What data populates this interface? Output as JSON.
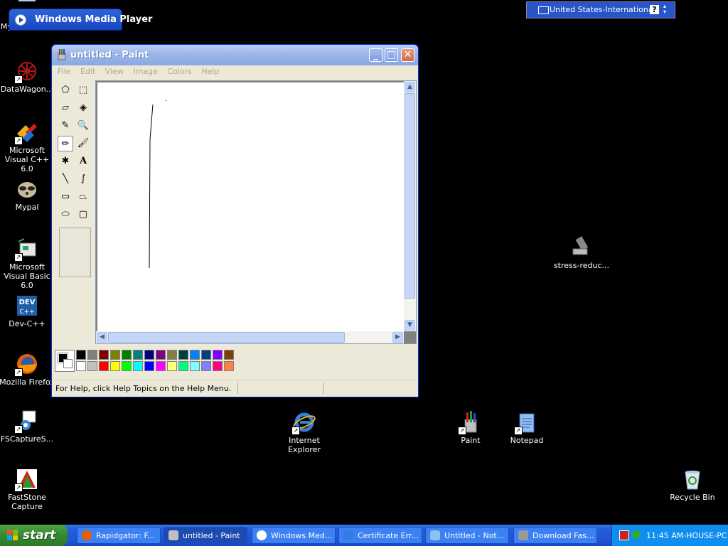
{
  "desktop": {
    "icons": [
      {
        "label": "My Computer"
      },
      {
        "label": "DataWagon..."
      },
      {
        "label": "Microsoft Visual C++ 6.0"
      },
      {
        "label": "Mypal"
      },
      {
        "label": "Microsoft Visual Basic 6.0"
      },
      {
        "label": "Dev-C++"
      },
      {
        "label": "Mozilla Firefox"
      },
      {
        "label": "FSCaptureS..."
      },
      {
        "label": "FastStone Capture"
      },
      {
        "label": "Internet Explorer"
      },
      {
        "label": "Paint"
      },
      {
        "label": "Notepad"
      },
      {
        "label": "stress-reduc..."
      },
      {
        "label": "Recycle Bin"
      }
    ]
  },
  "wmp_window": {
    "title": "Windows Media Player"
  },
  "language_bar": {
    "language": "United States-International",
    "help_label": "?"
  },
  "paint": {
    "title": "untitled - Paint",
    "menu": [
      "File",
      "Edit",
      "View",
      "Image",
      "Colors",
      "Help"
    ],
    "status_text": "For Help, click Help Topics on the Help Menu.",
    "tools": [
      {
        "icon": "free-form-select-icon",
        "glyph": "⬠"
      },
      {
        "icon": "rect-select-icon",
        "glyph": "⬚"
      },
      {
        "icon": "eraser-icon",
        "glyph": "▱"
      },
      {
        "icon": "fill-bucket-icon",
        "glyph": "◈"
      },
      {
        "icon": "color-picker-icon",
        "glyph": "✎"
      },
      {
        "icon": "magnifier-icon",
        "glyph": "🔍"
      },
      {
        "icon": "pencil-icon",
        "glyph": "✏"
      },
      {
        "icon": "brush-icon",
        "glyph": "🖌"
      },
      {
        "icon": "airbrush-icon",
        "glyph": "✱"
      },
      {
        "icon": "text-icon",
        "glyph": "A"
      },
      {
        "icon": "line-icon",
        "glyph": "╲"
      },
      {
        "icon": "curve-icon",
        "glyph": "∫"
      },
      {
        "icon": "rectangle-icon",
        "glyph": "▭"
      },
      {
        "icon": "polygon-icon",
        "glyph": "⏢"
      },
      {
        "icon": "ellipse-icon",
        "glyph": "⬭"
      },
      {
        "icon": "rounded-rectangle-icon",
        "glyph": "▢"
      }
    ],
    "selected_tool": "pencil",
    "palette_colors": [
      "#000000",
      "#808080",
      "#800000",
      "#808000",
      "#008000",
      "#008080",
      "#000080",
      "#800080",
      "#808040",
      "#004040",
      "#0080ff",
      "#004080",
      "#8000ff",
      "#804000",
      "#ffffff",
      "#c0c0c0",
      "#ff0000",
      "#ffff00",
      "#00ff00",
      "#00ffff",
      "#0000ff",
      "#ff00ff",
      "#ffff80",
      "#00ff80",
      "#80ffff",
      "#8080ff",
      "#ff0080",
      "#ff8040"
    ],
    "foreground_color": "#000000",
    "background_color": "#ffffff"
  },
  "taskbar": {
    "start_label": "start",
    "tasks": [
      {
        "label": "Rapidgator: F...",
        "icon": "firefox-icon"
      },
      {
        "label": "untitled - Paint",
        "icon": "paint-icon"
      },
      {
        "label": "Windows Med...",
        "icon": "media-player-icon"
      },
      {
        "label": "Certificate Err...",
        "icon": "ie-icon"
      },
      {
        "label": "Untitled - Not...",
        "icon": "notepad-icon"
      },
      {
        "label": "Download Fas...",
        "icon": "download-icon"
      }
    ],
    "clock": "11:45 AM-HOUSE-PC"
  }
}
